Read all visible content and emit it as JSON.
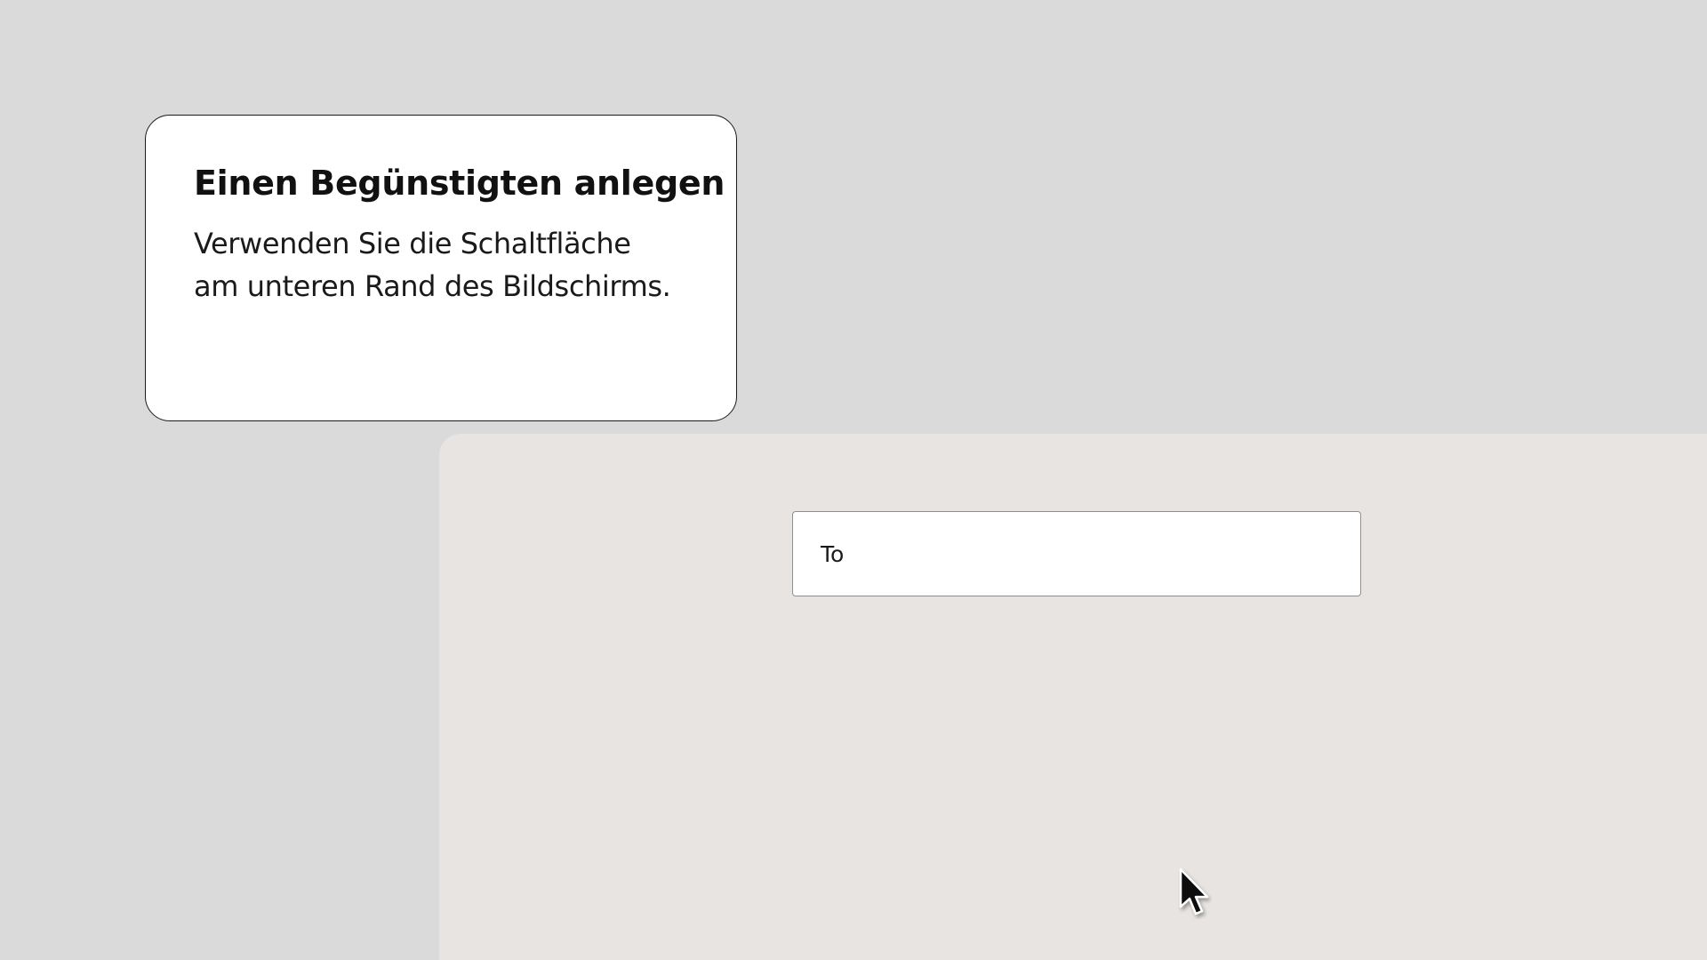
{
  "tooltip": {
    "title": "Einen Begünstigten anlegen",
    "body_line_1": "Verwenden Sie die Schaltfläche",
    "body_line_2": "am unteren Rand des Bildschirms."
  },
  "recipient_field": {
    "label": "To"
  },
  "colors": {
    "page_background": "#dadada",
    "panel_background": "#e7e4e1",
    "card_background": "#ffffff"
  },
  "icons": {
    "cursor": "mouse-pointer-icon"
  }
}
